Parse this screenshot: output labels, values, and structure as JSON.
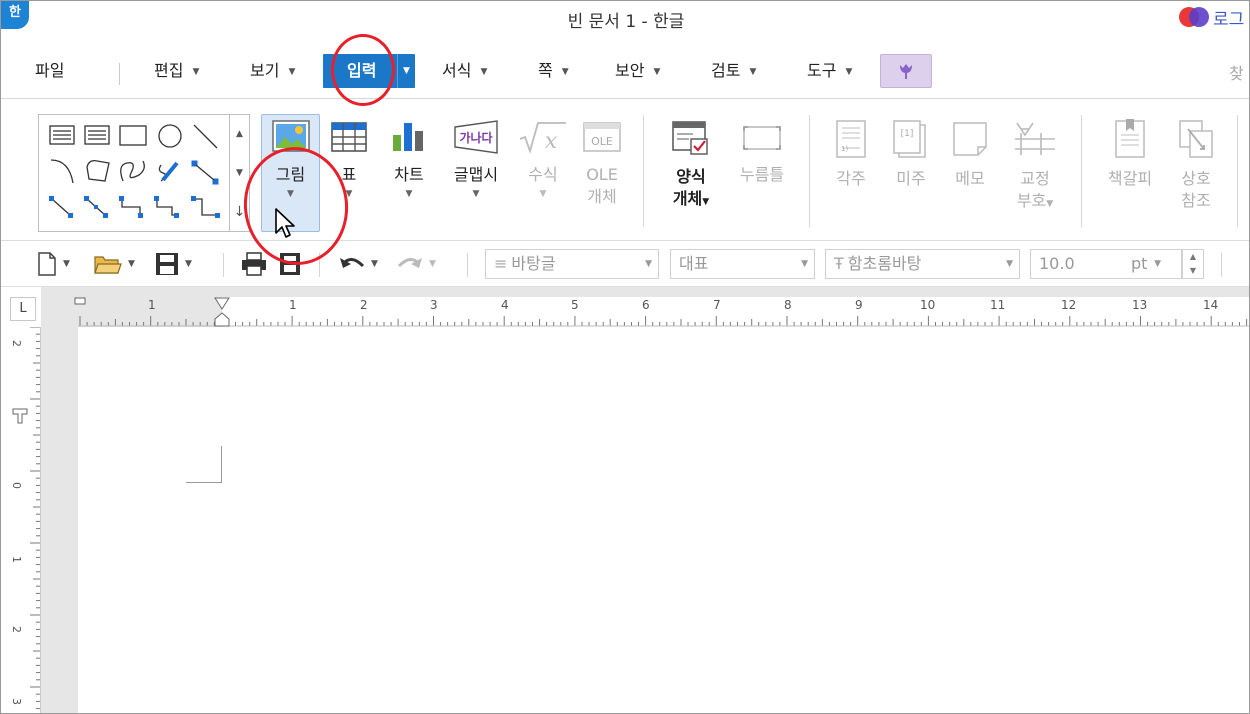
{
  "window": {
    "title": "빈 문서 1 - 한글",
    "app_logo": "한",
    "login_label": "로그"
  },
  "menu": {
    "items": [
      {
        "label": "파일",
        "has_arrow": false
      },
      {
        "label": "편집",
        "has_arrow": true
      },
      {
        "label": "보기",
        "has_arrow": true
      },
      {
        "label": "입력",
        "has_arrow": true,
        "active": true
      },
      {
        "label": "서식",
        "has_arrow": true
      },
      {
        "label": "쪽",
        "has_arrow": true
      },
      {
        "label": "보안",
        "has_arrow": true
      },
      {
        "label": "검토",
        "has_arrow": true
      },
      {
        "label": "도구",
        "has_arrow": true
      }
    ],
    "search_cut": "찾"
  },
  "ribbon": {
    "picture": {
      "label": "그림"
    },
    "table": {
      "label": "표"
    },
    "chart": {
      "label": "차트"
    },
    "glyph_art": {
      "label": "글맵시",
      "icon_text": "가나다"
    },
    "equation": {
      "label": "수식"
    },
    "ole": {
      "label1": "OLE",
      "label2": "개체",
      "icon_text": "OLE"
    },
    "form_object": {
      "label1": "양식",
      "label2": "개체"
    },
    "push_button": {
      "label": "누름틀"
    },
    "footnote": {
      "label": "각주"
    },
    "endnote": {
      "label": "미주"
    },
    "memo": {
      "label": "메모"
    },
    "proofread": {
      "label1": "교정",
      "label2": "부호"
    },
    "bookmark": {
      "label": "책갈피"
    },
    "cross_ref": {
      "label1": "상호",
      "label2": "참조"
    }
  },
  "toolbar": {
    "style_combo": "바탕글",
    "lang_combo": "대표",
    "font_combo": "함초롬바탕",
    "font_icon": "Ŧ",
    "size_value": "10.0",
    "size_unit": "pt"
  },
  "ruler": {
    "h_numbers": [
      "1",
      "1",
      "2",
      "3",
      "4",
      "5",
      "6",
      "7",
      "8",
      "9",
      "10",
      "11",
      "12",
      "13",
      "14"
    ],
    "v_numbers": [
      "2",
      "1",
      "0",
      "1",
      "2",
      "3"
    ],
    "corner": "L"
  },
  "colors": {
    "accent": "#1b78c8",
    "annotation": "#e8202a",
    "purple": "#dcd0ec"
  }
}
